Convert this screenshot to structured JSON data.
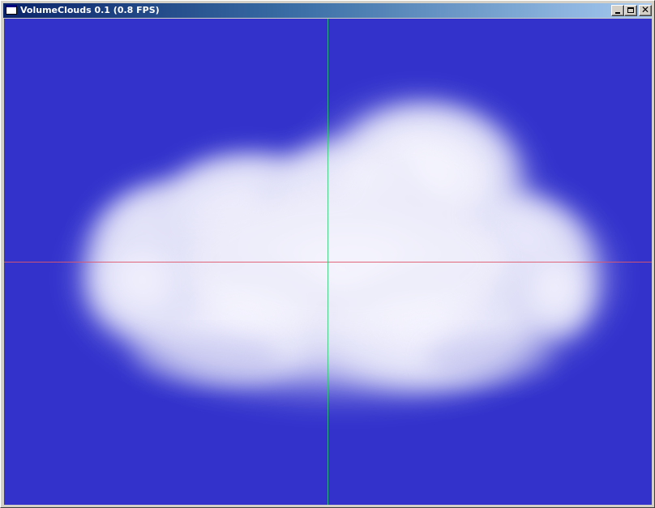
{
  "window": {
    "title": "VolumeClouds 0.1 (0.8 FPS)",
    "icon": "app-window-icon",
    "controls": {
      "minimize_icon": "minimize-icon",
      "maximize_icon": "maximize-icon",
      "close_icon": "close-icon",
      "close_glyph": "✕"
    }
  },
  "viewport": {
    "background_color": "#3333cc",
    "cloud_color": "#ffffff",
    "x_axis_color": "#e0566a",
    "y_axis_color": "#33cc77"
  }
}
